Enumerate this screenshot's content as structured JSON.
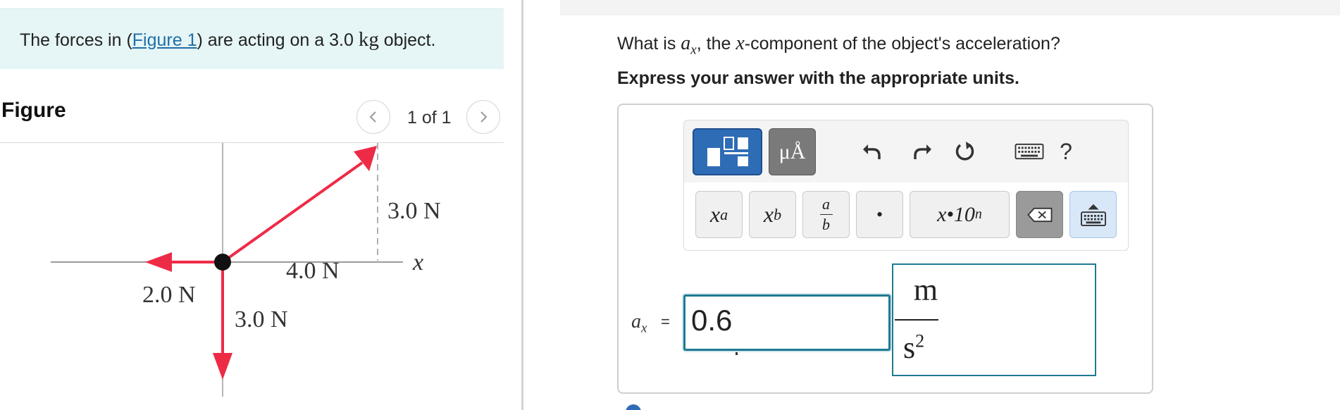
{
  "problem": {
    "text_before_link": "The forces in (",
    "link_label": "Figure 1",
    "text_after_link": ") are acting on a 3.0 ",
    "mass_unit": "kg",
    "text_end": " object."
  },
  "figure": {
    "heading": "Figure",
    "pager": "1 of 1",
    "labels": {
      "up_right_force": "3.0 N",
      "left_force": "2.0 N",
      "up_right_magnitude": "4.0 N",
      "down_force": "3.0 N",
      "x_axis": "x"
    },
    "colors": {
      "arrow": "#ee2b47",
      "axis": "#9a9a9a",
      "dashed": "#b0b0b0"
    }
  },
  "question": {
    "prefix": "What is ",
    "var_symbol": "a",
    "var_sub": "x",
    "middle": ", the ",
    "x_symbol": "x",
    "suffix": "-component of the object's acceleration?",
    "instruction": "Express your answer with the appropriate units."
  },
  "toolbar": {
    "units_label": "μÅ",
    "help_label": "?",
    "keys": {
      "sup_base": "x",
      "sup_exp": "a",
      "sub_base": "x",
      "sub_idx": "b",
      "frac_num": "a",
      "frac_den": "b",
      "dot": "•",
      "sci_base": "x•10",
      "sci_exp": "n"
    },
    "icons": [
      "templates-icon",
      "units-icon",
      "undo-icon",
      "redo-icon",
      "reset-icon",
      "keyboard-icon",
      "help-icon",
      "backspace-icon",
      "keyboard-toggle-icon"
    ],
    "colors": {
      "primary": "#2f6cb6",
      "answer_border": "#1f7a93"
    }
  },
  "answer": {
    "label_symbol": "a",
    "label_sub": "x",
    "equals": "=",
    "value": "0.6",
    "unit_numerator": "m",
    "unit_denominator": "s",
    "unit_exponent": "2"
  }
}
